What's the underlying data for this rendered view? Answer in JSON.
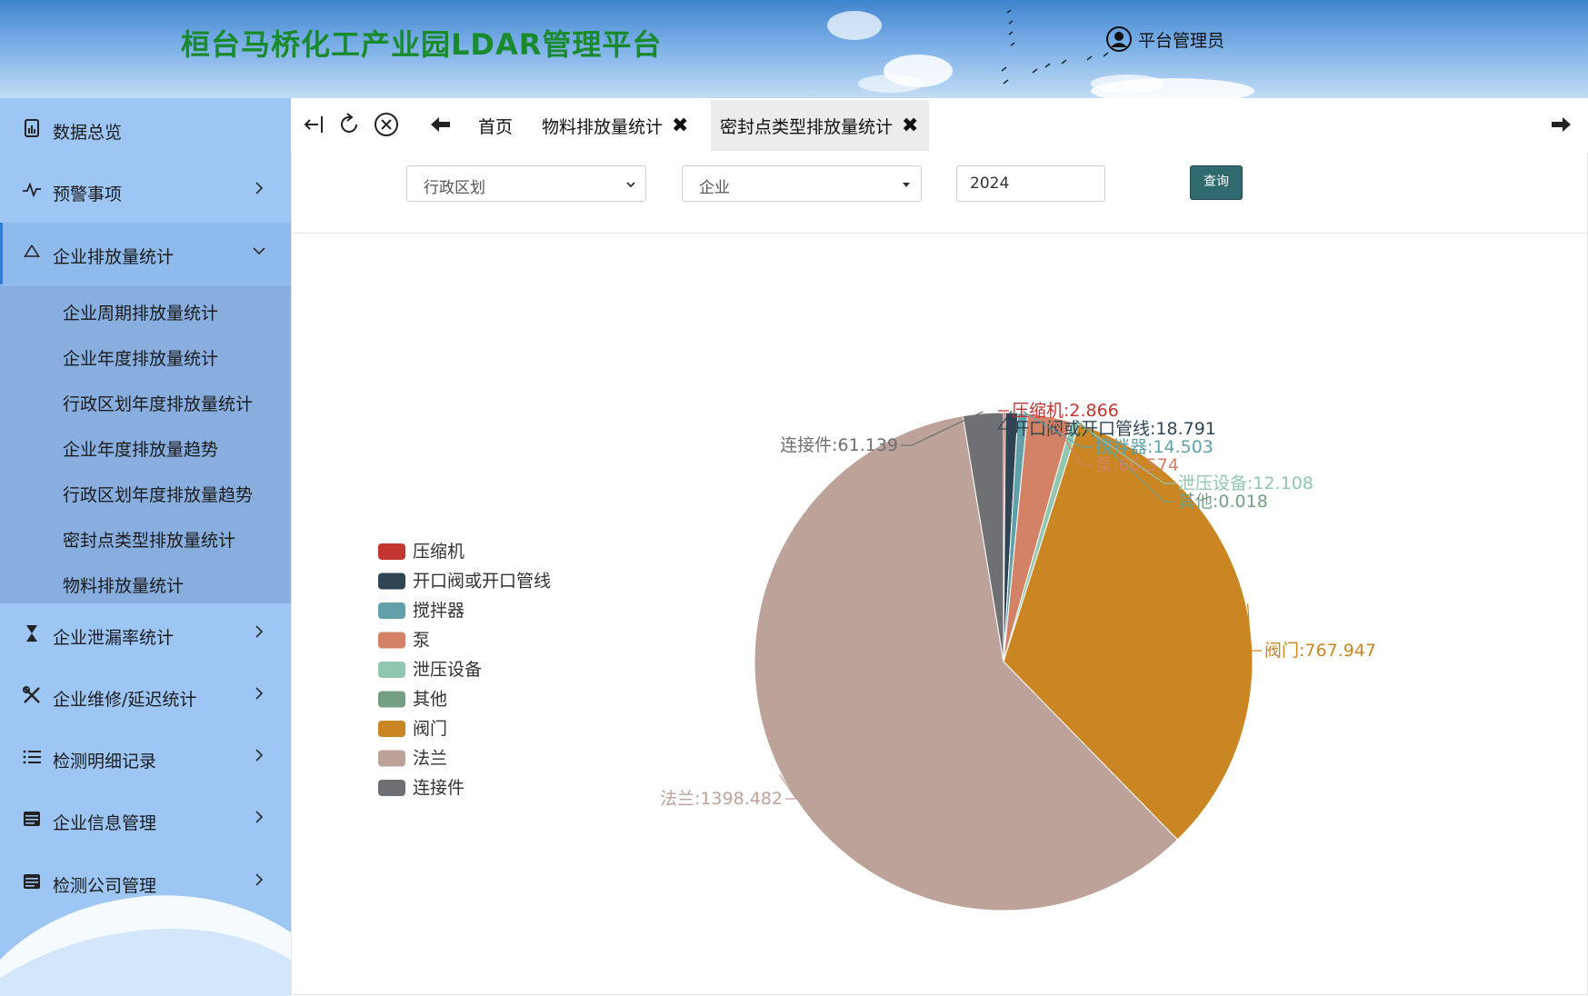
{
  "header": {
    "title": "桓台马桥化工产业园LDAR管理平台",
    "user_name": "平台管理员"
  },
  "sidebar": {
    "items": [
      {
        "label": "数据总览",
        "icon": "chart-icon"
      },
      {
        "label": "预警事项",
        "icon": "pulse-icon"
      },
      {
        "label": "企业排放量统计",
        "icon": "recycle-icon"
      },
      {
        "label": "企业泄漏率统计",
        "icon": "hourglass-icon"
      },
      {
        "label": "企业维修/延迟统计",
        "icon": "tools-icon"
      },
      {
        "label": "检测明细记录",
        "icon": "list-icon"
      },
      {
        "label": "企业信息管理",
        "icon": "card-icon"
      },
      {
        "label": "检测公司管理",
        "icon": "card-icon"
      }
    ],
    "submenu": [
      "企业周期排放量统计",
      "企业年度排放量统计",
      "行政区划年度排放量统计",
      "企业年度排放量趋势",
      "行政区划年度排放量趋势",
      "密封点类型排放量统计",
      "物料排放量统计"
    ]
  },
  "tabs": [
    {
      "label": "首页",
      "closable": false,
      "active": false
    },
    {
      "label": "物料排放量统计",
      "closable": true,
      "active": false
    },
    {
      "label": "密封点类型排放量统计",
      "closable": true,
      "active": true
    }
  ],
  "tab_close_glyph": "✖",
  "filters": {
    "region_selected": "行政区划",
    "company_selected": "企业",
    "year_value": "2024",
    "query_label": "查询"
  },
  "chart_data": {
    "type": "pie",
    "series": [
      {
        "name": "压缩机",
        "value": 2.866,
        "color": "#c23531"
      },
      {
        "name": "开口阀或开口管线",
        "value": 18.791,
        "color": "#2f4554"
      },
      {
        "name": "搅拌器",
        "value": 14.503,
        "color": "#61a0a8"
      },
      {
        "name": "泵",
        "value": 66.574,
        "color": "#d48265"
      },
      {
        "name": "泄压设备",
        "value": 12.108,
        "color": "#91c7ae"
      },
      {
        "name": "其他",
        "value": 0.018,
        "color": "#749f83"
      },
      {
        "name": "阀门",
        "value": 767.947,
        "color": "#ca8622"
      },
      {
        "name": "法兰",
        "value": 1398.482,
        "color": "#bda29a"
      },
      {
        "name": "连接件",
        "value": 61.139,
        "color": "#6e7074"
      }
    ],
    "legend_placement": "left",
    "label_format": "{name}:{value}"
  }
}
